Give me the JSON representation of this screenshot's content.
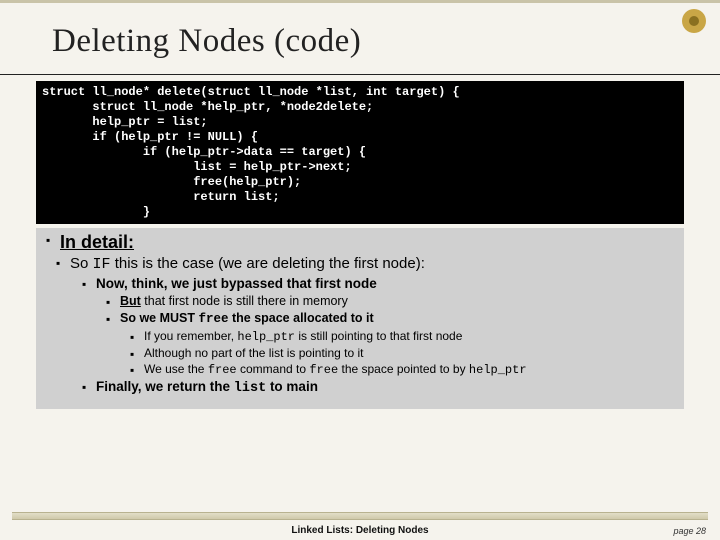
{
  "title": "Deleting Nodes (code)",
  "code": "struct ll_node* delete(struct ll_node *list, int target) {\n       struct ll_node *help_ptr, *node2delete;\n       help_ptr = list;\n       if (help_ptr != NULL) {\n              if (help_ptr->data == target) {\n                     list = help_ptr->next;\n                     free(help_ptr);\n                     return list;\n              }",
  "heading": "In detail:",
  "b1_pre": "So ",
  "b1_code": "IF",
  "b1_post": " this is the case (we are deleting the first node):",
  "b2": "Now, think, we just bypassed that first node",
  "b3_pre": "",
  "b3_under": "But",
  "b3_post": " that first node is still there in memory",
  "b4_pre": "So we MUST ",
  "b4_code": "free",
  "b4_post": " the space allocated to it",
  "b5_pre": "If you remember, ",
  "b5_code": "help_ptr",
  "b5_post": " is still pointing to that first node",
  "b6": "Although no part of the list is pointing to it",
  "b7_pre": "We use the ",
  "b7_code1": "free",
  "b7_mid": " command to ",
  "b7_code2": "free",
  "b7_mid2": " the space pointed to by ",
  "b7_code3": "help_ptr",
  "b8_pre": "Finally, we return the ",
  "b8_code": "list",
  "b8_post": " to main",
  "footer": "Linked Lists:  Deleting Nodes",
  "page": "page 28"
}
